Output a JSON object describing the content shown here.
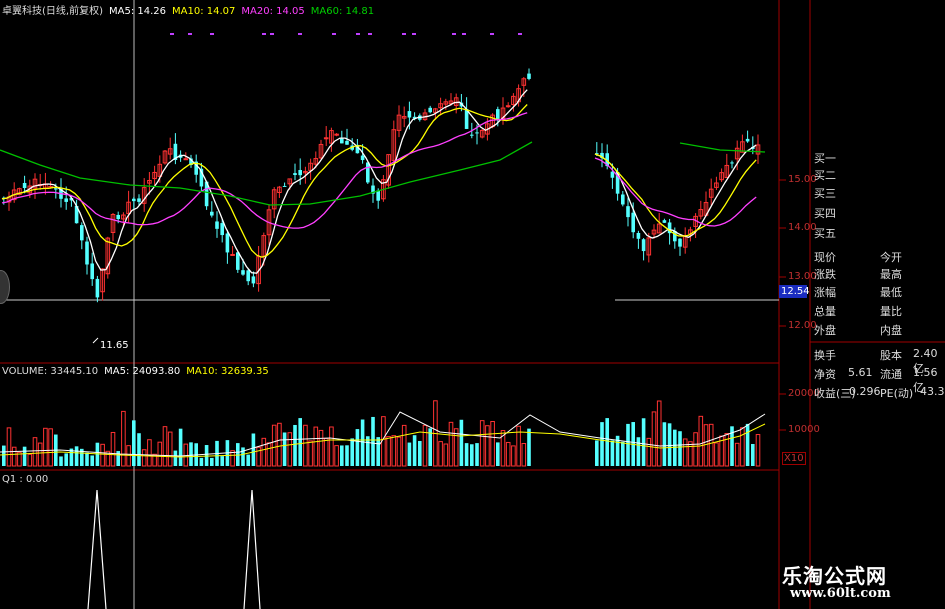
{
  "header": {
    "stock": "卓翼科技(日线,前复权)",
    "ma5": "MA5: 14.26",
    "ma10": "MA10: 14.07",
    "ma20": "MA20: 14.05",
    "ma60": "MA60: 14.81"
  },
  "price_axis": {
    "labels": [
      "15.00",
      "14.00",
      "13.00",
      "12.00"
    ],
    "current": "12.54"
  },
  "low_label": "11.65",
  "volume_header": {
    "volume": "VOLUME: 33445.10",
    "ma5": "MA5: 24093.80",
    "ma10": "MA10: 32639.35"
  },
  "volume_axis": {
    "labels": [
      "20000",
      "10000"
    ],
    "unit": "X10"
  },
  "indicator_header": "Q1 : 0.00",
  "order_book": [
    "买一",
    "买二",
    "买三",
    "买四",
    "买五"
  ],
  "quote": {
    "rows": [
      {
        "l": "现价",
        "r": "今开"
      },
      {
        "l": "涨跌",
        "r": "最高"
      },
      {
        "l": "涨幅",
        "r": "最低"
      },
      {
        "l": "总量",
        "r": "量比"
      },
      {
        "l": "外盘",
        "r": "内盘"
      }
    ],
    "fund": [
      {
        "l": "换手",
        "v1": "",
        "r": "股本",
        "v2": "2.40亿"
      },
      {
        "l": "净资",
        "v1": "5.61",
        "r": "流通",
        "v2": "1.56亿"
      },
      {
        "l": "收益(三)",
        "v1": "0.296",
        "r": "PE(动)",
        "v2": "43.3"
      }
    ]
  },
  "watermark": {
    "title": "乐淘公式网",
    "url": "www.60lt.com"
  },
  "colors": {
    "up": "#ff3232",
    "down": "#54ffff",
    "ma5": "#ffffff",
    "ma10": "#ffff00",
    "ma20": "#ff40ff",
    "ma60": "#00c000",
    "frame": "#b00000"
  }
}
